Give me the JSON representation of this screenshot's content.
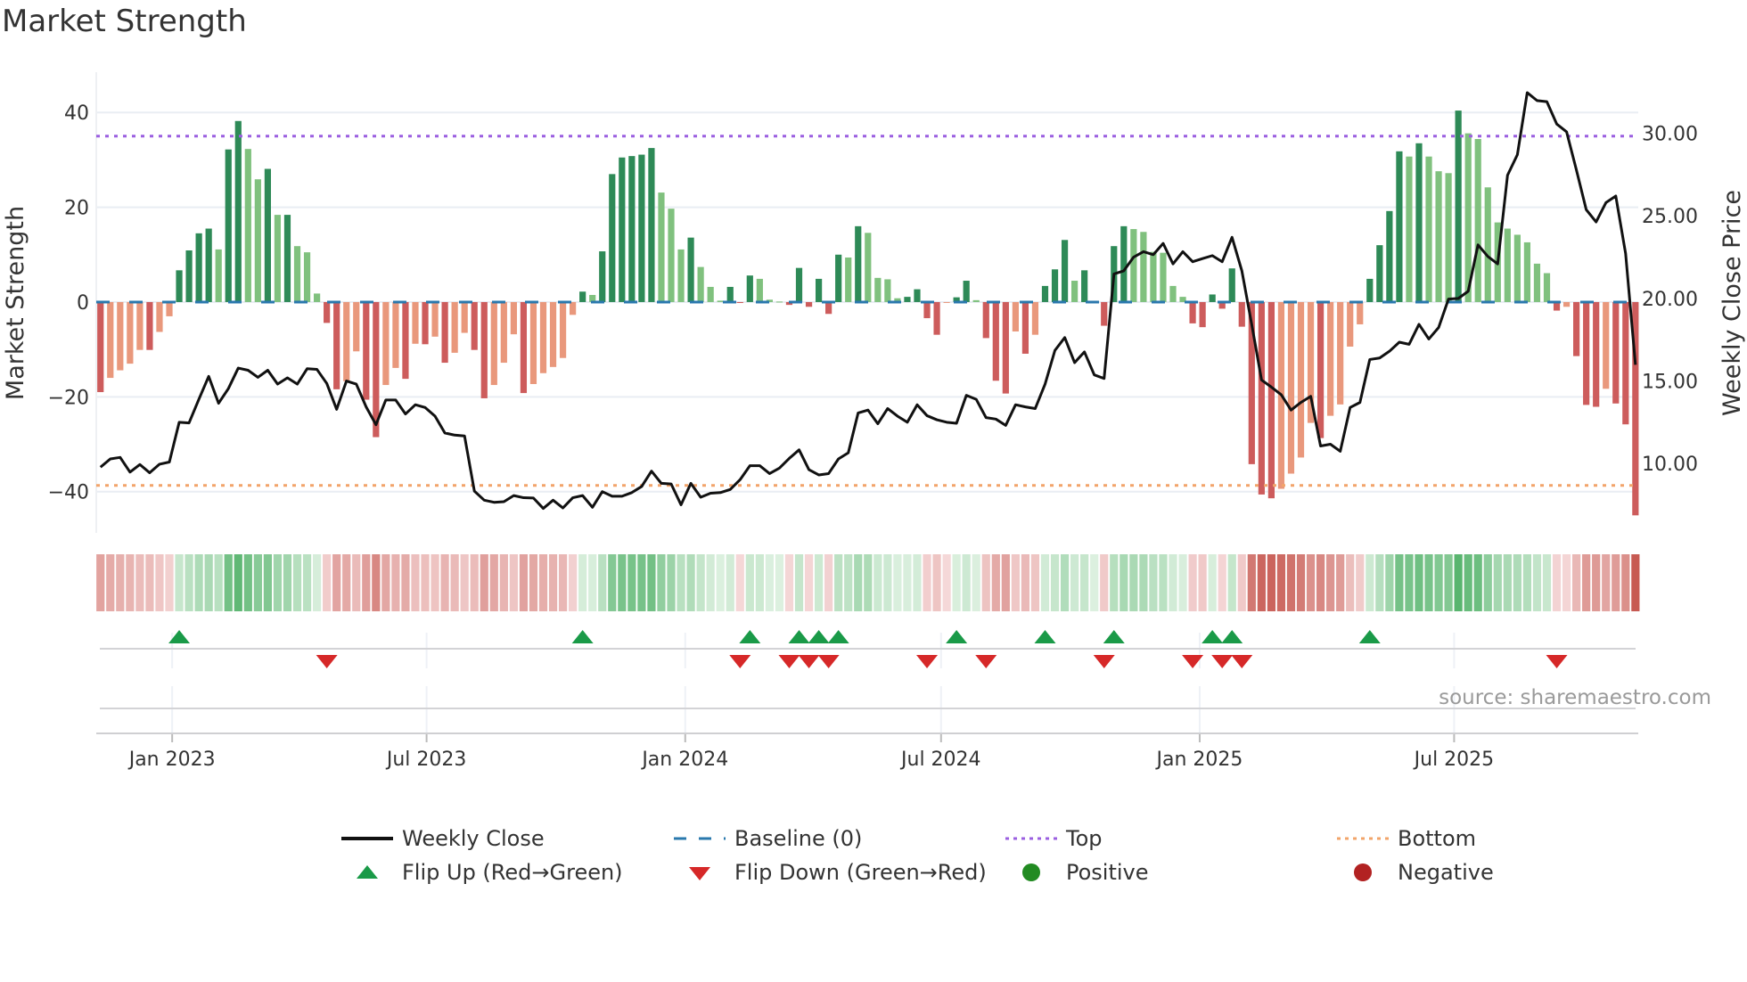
{
  "title": "Market Strength",
  "source": "source: sharemaestro.com",
  "colors": {
    "pos_dark": "#2e8a57",
    "pos_light": "#80c17e",
    "neg_dark": "#cd5c5c",
    "neg_light": "#e9987c",
    "baseline": "#2a78ad",
    "top": "#9b5fe0",
    "bottom": "#f2a46a",
    "line": "#111111",
    "flip_up": "#1a9a48",
    "flip_down": "#d62828",
    "positive": "#228b22",
    "negative": "#b22222"
  },
  "legend": [
    {
      "label": "Weekly Close",
      "symbol": "line"
    },
    {
      "label": "Baseline (0)",
      "symbol": "dash"
    },
    {
      "label": "Top",
      "symbol": "dot-top"
    },
    {
      "label": "Bottom",
      "symbol": "dot-bottom"
    },
    {
      "label": "Flip Up (Red→Green)",
      "symbol": "tri-up"
    },
    {
      "label": "Flip Down (Green→Red)",
      "symbol": "tri-down"
    },
    {
      "label": "Positive",
      "symbol": "circle-pos"
    },
    {
      "label": "Negative",
      "symbol": "circle-neg"
    }
  ],
  "chart_data": {
    "type": "bar",
    "title": "Market Strength",
    "ylabel": "Market Strength",
    "y2label": "Weekly Close Price",
    "xlabel": "",
    "start_date": "2022-11-11",
    "frequency": "weekly",
    "xlim": [
      "2022-11-08",
      "2025-11-09"
    ],
    "ylim": [
      -48.7,
      48.5
    ],
    "y2lim": [
      5.8,
      33.7
    ],
    "yticks": [
      40,
      20,
      0,
      -20,
      -40
    ],
    "ytick_labels": [
      "40",
      "20",
      "0",
      "−20",
      "−40"
    ],
    "y2ticks": [
      30,
      25,
      20,
      15,
      10
    ],
    "y2tick_labels": [
      "30.00",
      "25.00",
      "20.00",
      "15.00",
      "10.00"
    ],
    "xticks": [
      "2023-01-01",
      "2023-07-01",
      "2024-01-01",
      "2024-07-01",
      "2025-01-01",
      "2025-07-01"
    ],
    "xtick_labels": [
      "Jan 2023",
      "Jul 2023",
      "Jan 2024",
      "Jul 2024",
      "Jan 2025",
      "Jul 2025"
    ],
    "top_level": 35,
    "bottom_level": -38.7,
    "baseline": 0,
    "grid": true,
    "legend_position": "bottom",
    "series": [
      {
        "name": "Market Strength",
        "type": "bar",
        "axis": "left",
        "values": [
          -19,
          -16,
          -14.4,
          -13,
          -10.1,
          -10.1,
          -6.3,
          -3,
          6.7,
          10.9,
          14.5,
          15.5,
          11.1,
          32.2,
          38.2,
          32.3,
          25.9,
          28.1,
          18.4,
          18.4,
          11.8,
          10.5,
          1.8,
          -4.4,
          -18.4,
          -16.7,
          -10.4,
          -20.6,
          -28.5,
          -17.5,
          -13.9,
          -16.2,
          -8.8,
          -8.9,
          -7.3,
          -12.8,
          -10.7,
          -6.5,
          -10.1,
          -20.3,
          -17.5,
          -12.8,
          -6.8,
          -19.2,
          -17.3,
          -15,
          -13.7,
          -11.8,
          -2.7,
          2.2,
          1.5,
          10.7,
          27,
          30.5,
          30.8,
          31.1,
          32.5,
          23.1,
          19.7,
          11.1,
          13.6,
          7.4,
          3.2,
          0.3,
          3.2,
          -0.2,
          5.6,
          4.9,
          0.5,
          0.1,
          -0.6,
          7.2,
          -1,
          4.9,
          -2.5,
          10,
          9.4,
          16,
          14.6,
          5.1,
          4.8,
          0.8,
          1.1,
          2.7,
          -3.4,
          -6.9,
          -0.1,
          1,
          4.5,
          0.4,
          -7.6,
          -16.6,
          -19.3,
          -6.2,
          -10.9,
          -6.9,
          3.4,
          6.9,
          13.1,
          4.5,
          6.7,
          0.1,
          -5,
          11.8,
          16,
          15.4,
          14.8,
          10.6,
          10.4,
          3.4,
          1.1,
          -4.5,
          -5.3,
          1.6,
          -1.4,
          7.1,
          -5.2,
          -34.2,
          -40.6,
          -41.4,
          -39.4,
          -36.2,
          -32.8,
          -25.5,
          -28.7,
          -24,
          -21.6,
          -9.4,
          -4.7,
          4.9,
          12,
          19.2,
          31.8,
          30.7,
          33.5,
          30.7,
          27.6,
          27.2,
          40.4,
          35.6,
          34.4,
          24.2,
          16.8,
          15.5,
          14.2,
          12.6,
          8.1,
          6.1,
          -1.8,
          -1,
          -11.4,
          -21.7,
          -22.1,
          -18.3,
          -21.4,
          -25.8,
          -45
        ]
      },
      {
        "name": "Weekly Close",
        "type": "line",
        "axis": "right",
        "values": [
          9.78,
          10.28,
          10.37,
          9.48,
          9.94,
          9.44,
          9.96,
          10.09,
          12.5,
          12.46,
          13.89,
          15.28,
          13.65,
          14.54,
          15.78,
          15.65,
          15.22,
          15.65,
          14.81,
          15.19,
          14.81,
          15.74,
          15.7,
          14.85,
          13.28,
          15.0,
          14.81,
          13.43,
          12.35,
          13.85,
          13.85,
          13.0,
          13.56,
          13.39,
          12.87,
          11.85,
          11.72,
          11.67,
          8.33,
          7.78,
          7.65,
          7.69,
          8.06,
          7.93,
          7.91,
          7.28,
          7.78,
          7.31,
          7.93,
          8.06,
          7.35,
          8.3,
          8.02,
          8.02,
          8.24,
          8.61,
          9.54,
          8.8,
          8.76,
          7.5,
          8.8,
          7.96,
          8.2,
          8.24,
          8.43,
          9.02,
          9.87,
          9.87,
          9.39,
          9.72,
          10.31,
          10.83,
          9.63,
          9.31,
          9.39,
          10.28,
          10.65,
          13.06,
          13.24,
          12.41,
          13.33,
          12.87,
          12.5,
          13.56,
          12.9,
          12.65,
          12.5,
          12.44,
          14.13,
          13.89,
          12.78,
          12.69,
          12.31,
          13.56,
          13.43,
          13.33,
          14.81,
          16.85,
          17.63,
          16.11,
          16.76,
          15.37,
          15.15,
          21.48,
          21.67,
          22.5,
          22.83,
          22.65,
          23.33,
          22.09,
          22.83,
          22.22,
          22.41,
          22.59,
          22.22,
          23.7,
          21.67,
          18.43,
          15.06,
          14.63,
          14.17,
          13.24,
          13.7,
          14.07,
          11.06,
          11.17,
          10.74,
          13.39,
          13.7,
          16.3,
          16.39,
          16.8,
          17.35,
          17.22,
          18.43,
          17.54,
          18.24,
          19.96,
          20.0,
          20.43,
          23.24,
          22.54,
          22.09,
          27.46,
          28.7,
          32.46,
          31.98,
          31.91,
          30.56,
          30.09,
          27.78,
          25.37,
          24.63,
          25.8,
          26.2,
          22.72,
          15.98
        ]
      }
    ]
  }
}
